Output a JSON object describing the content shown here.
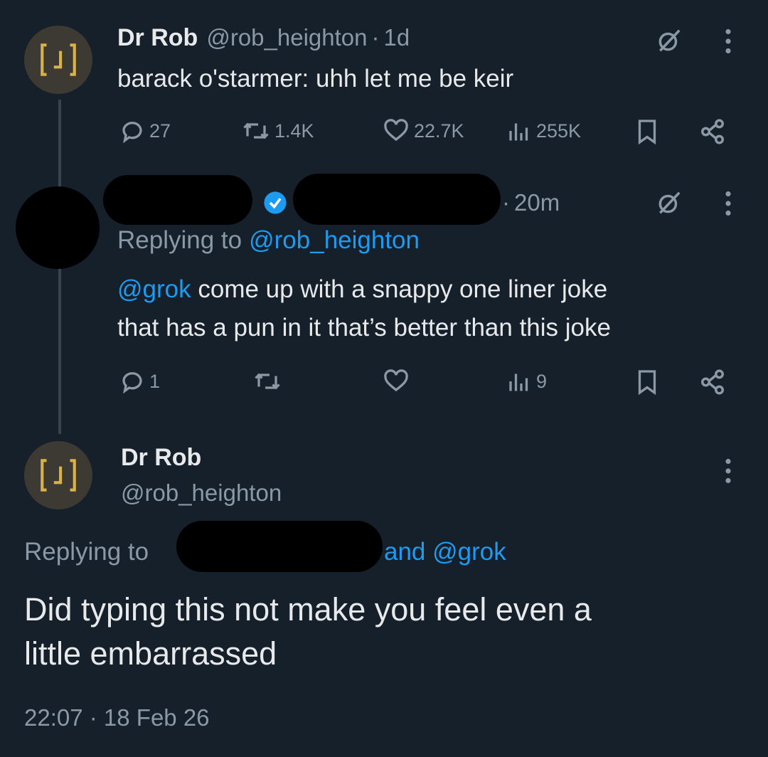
{
  "tweet1": {
    "display_name": "Dr Rob",
    "handle": "@rob_heighton",
    "sep": "·",
    "time": "1d",
    "text": "barack o'starmer: uhh let me be keir",
    "stats": {
      "replies": "27",
      "reposts": "1.4K",
      "likes": "22.7K",
      "views": "255K"
    }
  },
  "tweet2": {
    "sep": "·",
    "time": "20m",
    "replying_prefix": "Replying to",
    "replying_handle": "@rob_heighton",
    "mention": "@grok",
    "text_line1": " come up with a snappy one liner joke",
    "text_line2": "that has a pun in it that’s better than this joke",
    "stats": {
      "replies": "1",
      "views": "9"
    }
  },
  "tweet3": {
    "display_name": "Dr Rob",
    "handle": "@rob_heighton",
    "replying_prefix": "Replying to",
    "replying_suffix": "and @grok",
    "text_line1": "Did typing this not make you feel even a",
    "text_line2": "little embarrassed",
    "timestamp": "22:07 · 18 Feb 26"
  },
  "colors": {
    "background": "#15202b",
    "accent": "#1d9bf0",
    "muted": "#8b98a5",
    "avatar_logo": "#d8b34a"
  },
  "icons": [
    "grok-icon",
    "more-icon",
    "reply-icon",
    "repost-icon",
    "like-icon",
    "views-icon",
    "bookmark-icon",
    "share-icon",
    "verified-icon"
  ]
}
